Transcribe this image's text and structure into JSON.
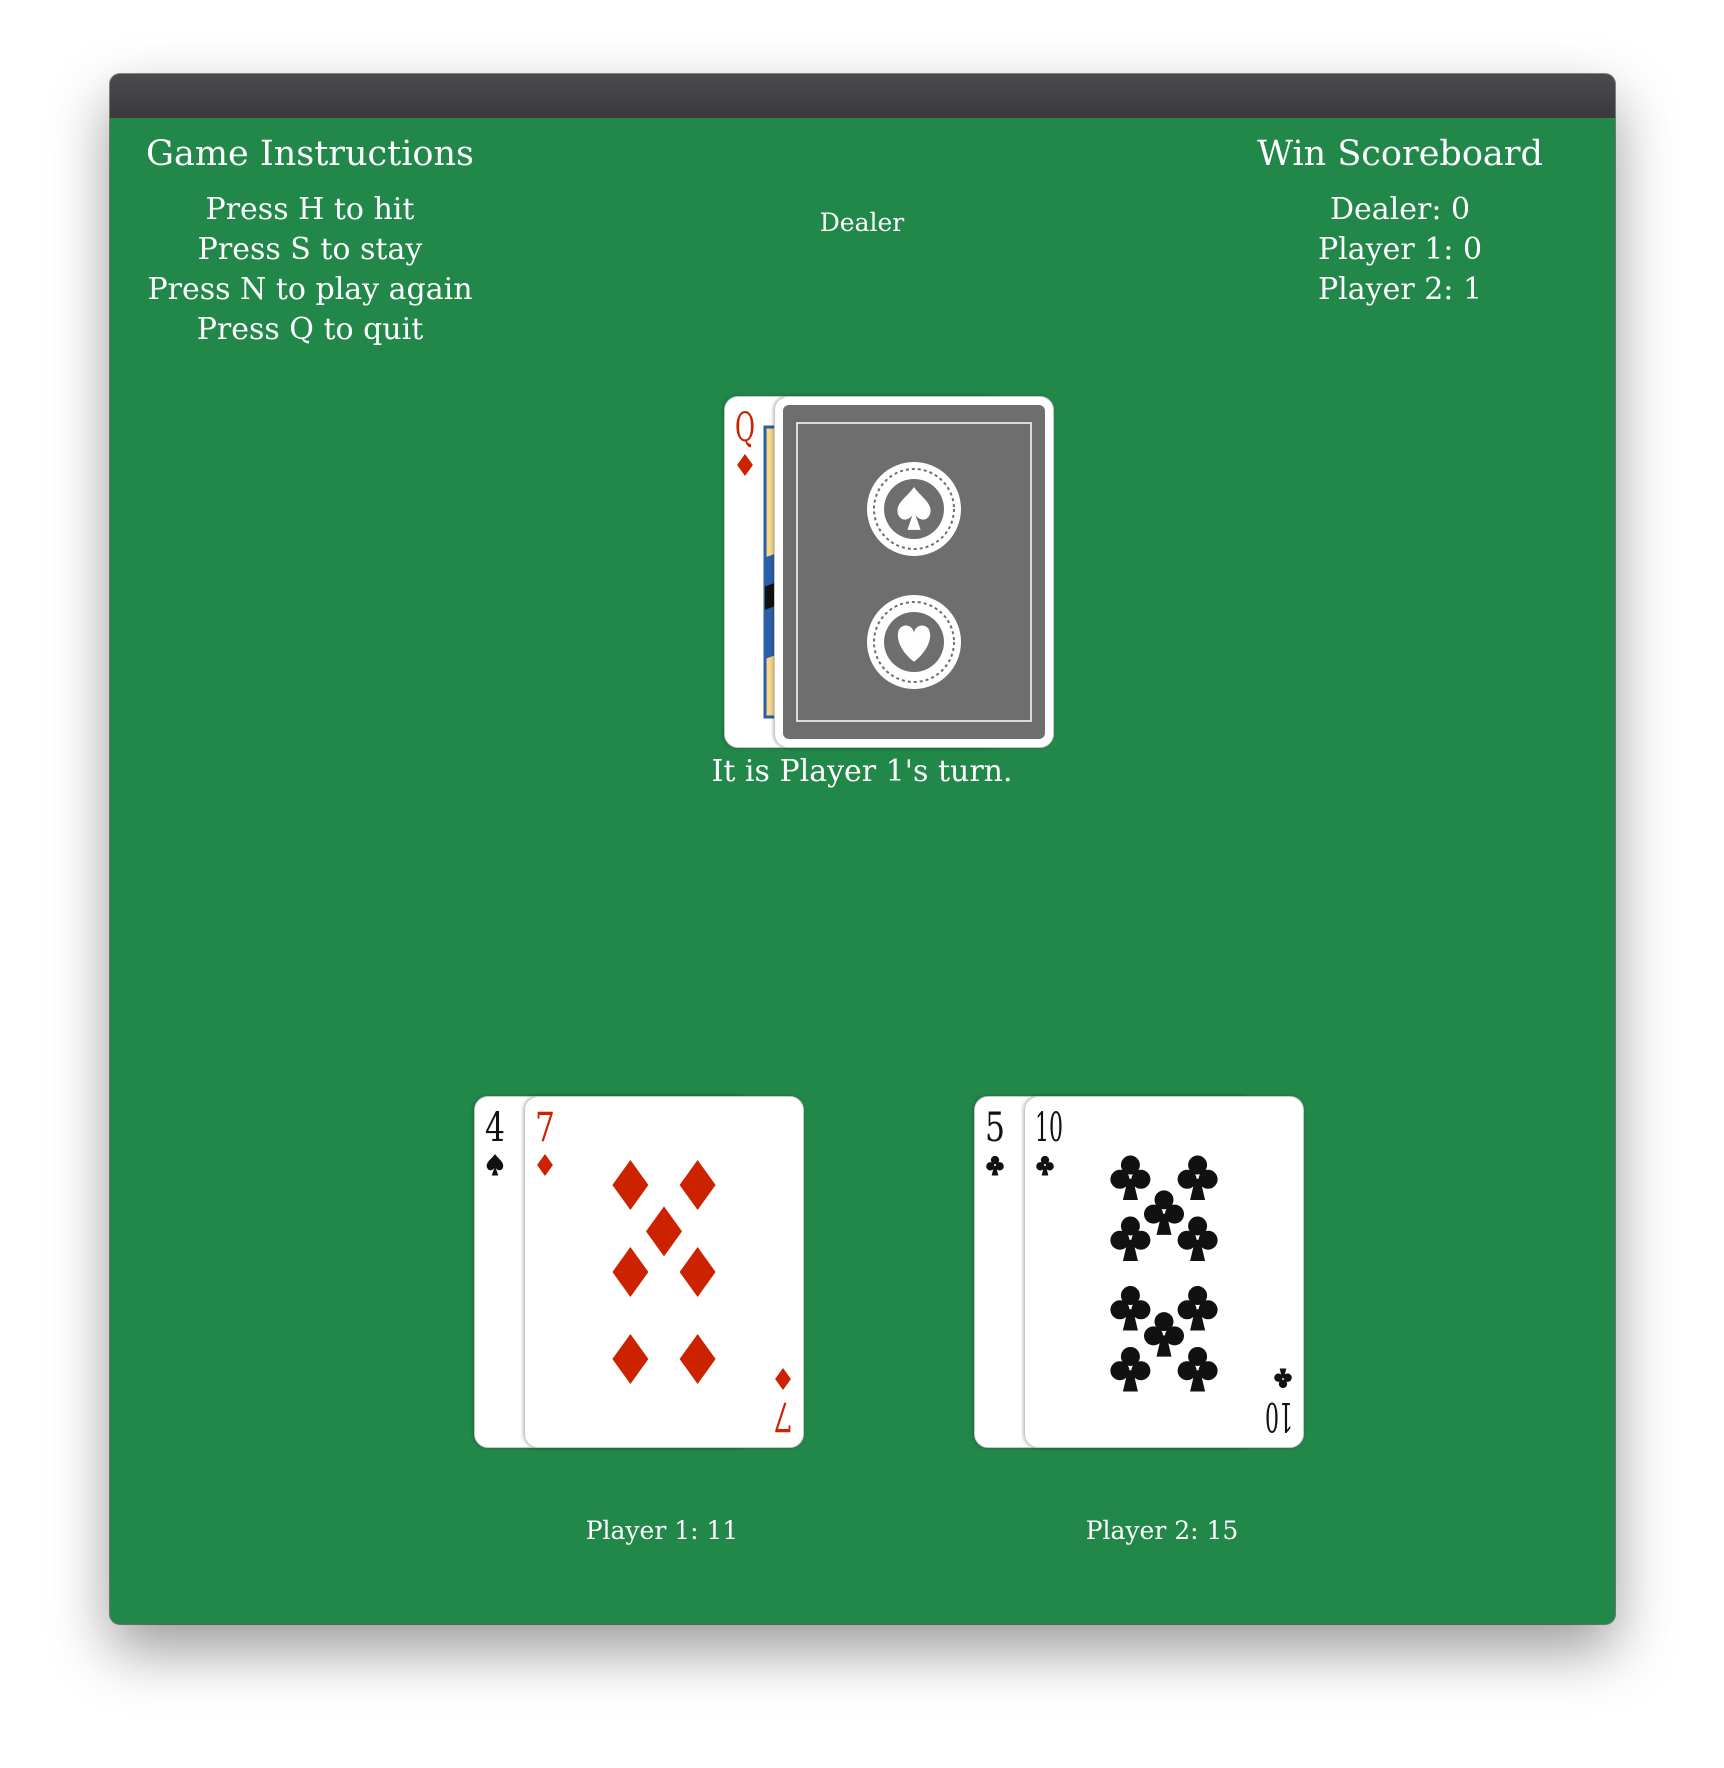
{
  "instructions": {
    "title": "Game Instructions",
    "lines": [
      "Press H to hit",
      "Press S to stay",
      "Press N to play again",
      "Press Q to quit"
    ]
  },
  "scoreboard": {
    "title": "Win Scoreboard",
    "lines": [
      "Dealer: 0",
      "Player 1: 0",
      "Player 2: 1"
    ]
  },
  "dealer": {
    "label": "Dealer",
    "cards": [
      {
        "rank": "Q",
        "suit": "diamond",
        "face_down": false
      },
      {
        "rank": "",
        "suit": "",
        "face_down": true
      }
    ]
  },
  "status": {
    "message": "It is Player 1's turn."
  },
  "players": [
    {
      "total_label": "Player 1: 11",
      "cards": [
        {
          "rank": "4",
          "suit": "spade",
          "face_down": false
        },
        {
          "rank": "7",
          "suit": "diamond",
          "face_down": false
        }
      ]
    },
    {
      "total_label": "Player 2: 15",
      "cards": [
        {
          "rank": "5",
          "suit": "club",
          "face_down": false
        },
        {
          "rank": "10",
          "suit": "club",
          "face_down": false
        }
      ]
    }
  ],
  "colors": {
    "felt": "#21884a",
    "red_suit": "#cc2200",
    "black_suit": "#111111",
    "card_back": "#6e6e6e"
  }
}
